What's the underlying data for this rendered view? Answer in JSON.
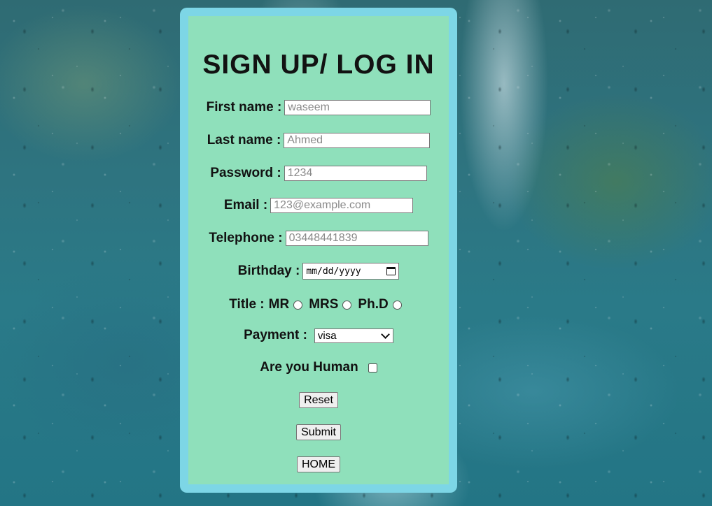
{
  "form": {
    "title": "SIGN UP/ LOG IN",
    "first_name": {
      "label": "First name :",
      "placeholder": "waseem"
    },
    "last_name": {
      "label": "Last name :",
      "placeholder": "Ahmed"
    },
    "password": {
      "label": "Password :",
      "placeholder": "1234"
    },
    "email": {
      "label": "Email :",
      "placeholder": "123@example.com"
    },
    "telephone": {
      "label": "Telephone :",
      "placeholder": "03448441839"
    },
    "birthday": {
      "label": "Birthday :",
      "value": "mm/dd/yyyy"
    },
    "title_field": {
      "label": "Title :",
      "options": [
        "MR",
        "MRS",
        "Ph.D"
      ]
    },
    "payment": {
      "label": "Payment :",
      "selected": "visa"
    },
    "human": {
      "label": "Are you Human"
    },
    "buttons": {
      "reset": "Reset",
      "submit": "Submit",
      "home": "HOME"
    }
  },
  "colors": {
    "card_border": "#7dd6e6",
    "card_fill": "#8fe0bb",
    "text": "#121212"
  }
}
